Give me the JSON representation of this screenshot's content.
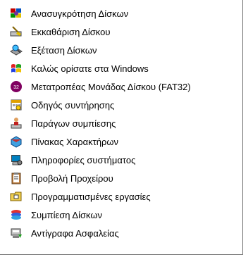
{
  "menu": {
    "items": [
      {
        "label": "Ανασυγκρότηση Δίσκων",
        "icon": "disk-defragmenter-icon"
      },
      {
        "label": "Εκκαθάριση Δίσκου",
        "icon": "disk-cleanup-icon"
      },
      {
        "label": "Εξέταση Δίσκων",
        "icon": "scandisk-icon"
      },
      {
        "label": "Καλώς ορίσατε στα Windows",
        "icon": "welcome-windows-icon"
      },
      {
        "label": "Μετατροπέας Μονάδας Δίσκου (FAT32)",
        "icon": "fat32-converter-icon"
      },
      {
        "label": "Οδηγός συντήρησης",
        "icon": "maintenance-wizard-icon"
      },
      {
        "label": "Παράγων συμπίεσης",
        "icon": "compression-agent-icon"
      },
      {
        "label": "Πίνακας Χαρακτήρων",
        "icon": "character-map-icon"
      },
      {
        "label": "Πληροφορίες συστήματος",
        "icon": "system-information-icon"
      },
      {
        "label": "Προβολή Προχείρου",
        "icon": "clipboard-viewer-icon"
      },
      {
        "label": "Προγραμματισμένες εργασίες",
        "icon": "scheduled-tasks-icon"
      },
      {
        "label": "Συμπίεση Δίσκων",
        "icon": "drivespace-icon"
      },
      {
        "label": "Αντίγραφα Ασφαλείας",
        "icon": "backup-icon"
      }
    ]
  }
}
